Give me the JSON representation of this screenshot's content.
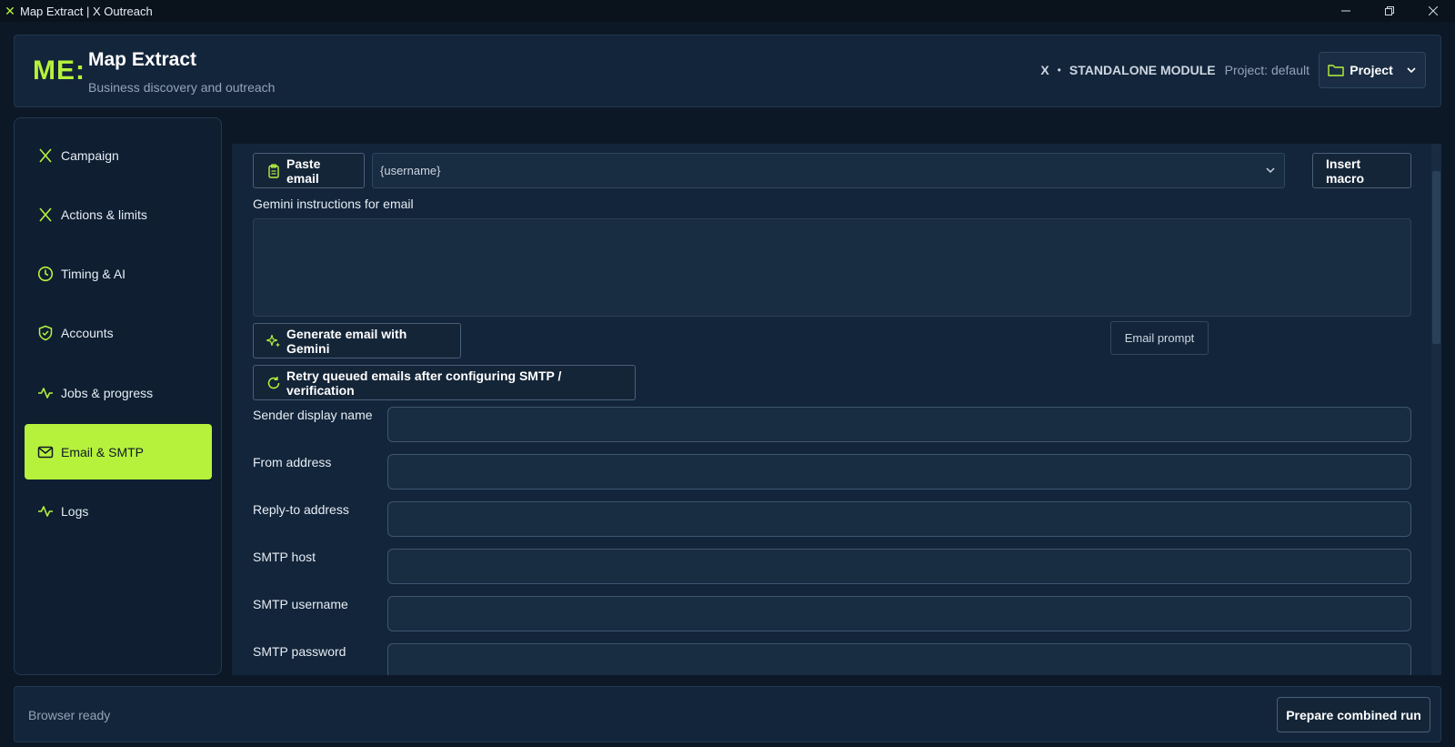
{
  "window": {
    "title": "Map Extract | X Outreach",
    "controls": [
      "minimize",
      "restore",
      "close"
    ]
  },
  "header": {
    "logo": "ME:",
    "title": "Map Extract",
    "subtitle": "Business discovery and outreach",
    "platform": "X",
    "module_label": "STANDALONE MODULE",
    "project_text": "Project: default",
    "project_button": "Project"
  },
  "sidebar": {
    "items": [
      {
        "label": "Campaign",
        "icon": "x-icon",
        "active": false
      },
      {
        "label": "Actions & limits",
        "icon": "x-icon",
        "active": false
      },
      {
        "label": "Timing & AI",
        "icon": "clock-icon",
        "active": false
      },
      {
        "label": "Accounts",
        "icon": "shield-check-icon",
        "active": false
      },
      {
        "label": "Jobs & progress",
        "icon": "activity-icon",
        "active": false
      },
      {
        "label": "Email & SMTP",
        "icon": "mail-icon",
        "active": true
      },
      {
        "label": "Logs",
        "icon": "activity-icon",
        "active": false
      }
    ]
  },
  "email": {
    "paste_button": "Paste email",
    "macro_select_value": "{username}",
    "insert_macro_button": "Insert macro",
    "gemini_label": "Gemini instructions for email",
    "gemini_value": "",
    "generate_button": "Generate email with Gemini",
    "tooltip": "Email prompt",
    "retry_button": "Retry queued emails after configuring SMTP / verification",
    "fields": [
      {
        "label": "Sender display name",
        "value": ""
      },
      {
        "label": "From address",
        "value": ""
      },
      {
        "label": "Reply-to address",
        "value": ""
      },
      {
        "label": "SMTP host",
        "value": ""
      },
      {
        "label": "SMTP username",
        "value": ""
      },
      {
        "label": "SMTP password",
        "value": ""
      }
    ]
  },
  "footer": {
    "status": "Browser ready",
    "run_button": "Prepare combined run"
  },
  "colors": {
    "accent": "#b6f23c",
    "background": "#0c1826",
    "panel": "#13253a",
    "input": "#182c42"
  }
}
